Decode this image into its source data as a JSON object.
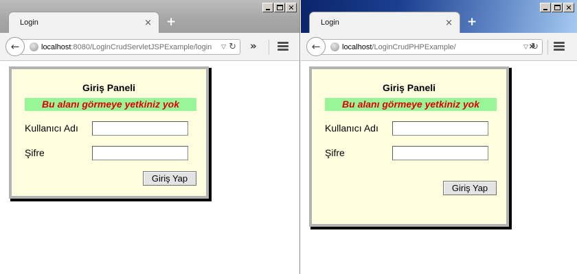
{
  "windows": [
    {
      "tab_title": "Login",
      "tab_close": "×",
      "new_tab": "+",
      "url_host": "localhost",
      "url_path": ":8080/LoginCrudServletJSPExample/login",
      "panel": {
        "title": "Giriş Paneli",
        "alert": "Bu alanı görmeye yetkiniz yok",
        "username_label": "Kullanıcı Adı",
        "username_value": "",
        "password_label": "Şifre",
        "password_value": "",
        "submit_label": "Giriş Yap"
      }
    },
    {
      "tab_title": "Login",
      "tab_close": "×",
      "new_tab": "+",
      "url_host": "localhost",
      "url_path": "/LoginCrudPHPExample/",
      "panel": {
        "title": "Giriş Paneli",
        "alert": "Bu alanı görmeye yetkiniz yok",
        "username_label": "Kullanıcı Adı",
        "username_value": "",
        "password_label": "Şifre",
        "password_value": "",
        "submit_label": "Giriş Yap"
      }
    }
  ],
  "icons": {
    "back": "back-arrow-icon",
    "site": "globe-icon",
    "dropdown": "url-dropdown-icon",
    "reload": "reload-icon",
    "overflow": "chevron-double-right-icon",
    "menu": "hamburger-menu-icon",
    "minimize": "minimize-icon",
    "maximize": "maximize-icon",
    "close": "close-icon"
  },
  "colors": {
    "panel_background": "#ffffe0",
    "alert_background": "#98f598",
    "alert_text": "#e00000",
    "panel_border": "#b3b3b3",
    "active_titlebar": "#0a246a"
  }
}
